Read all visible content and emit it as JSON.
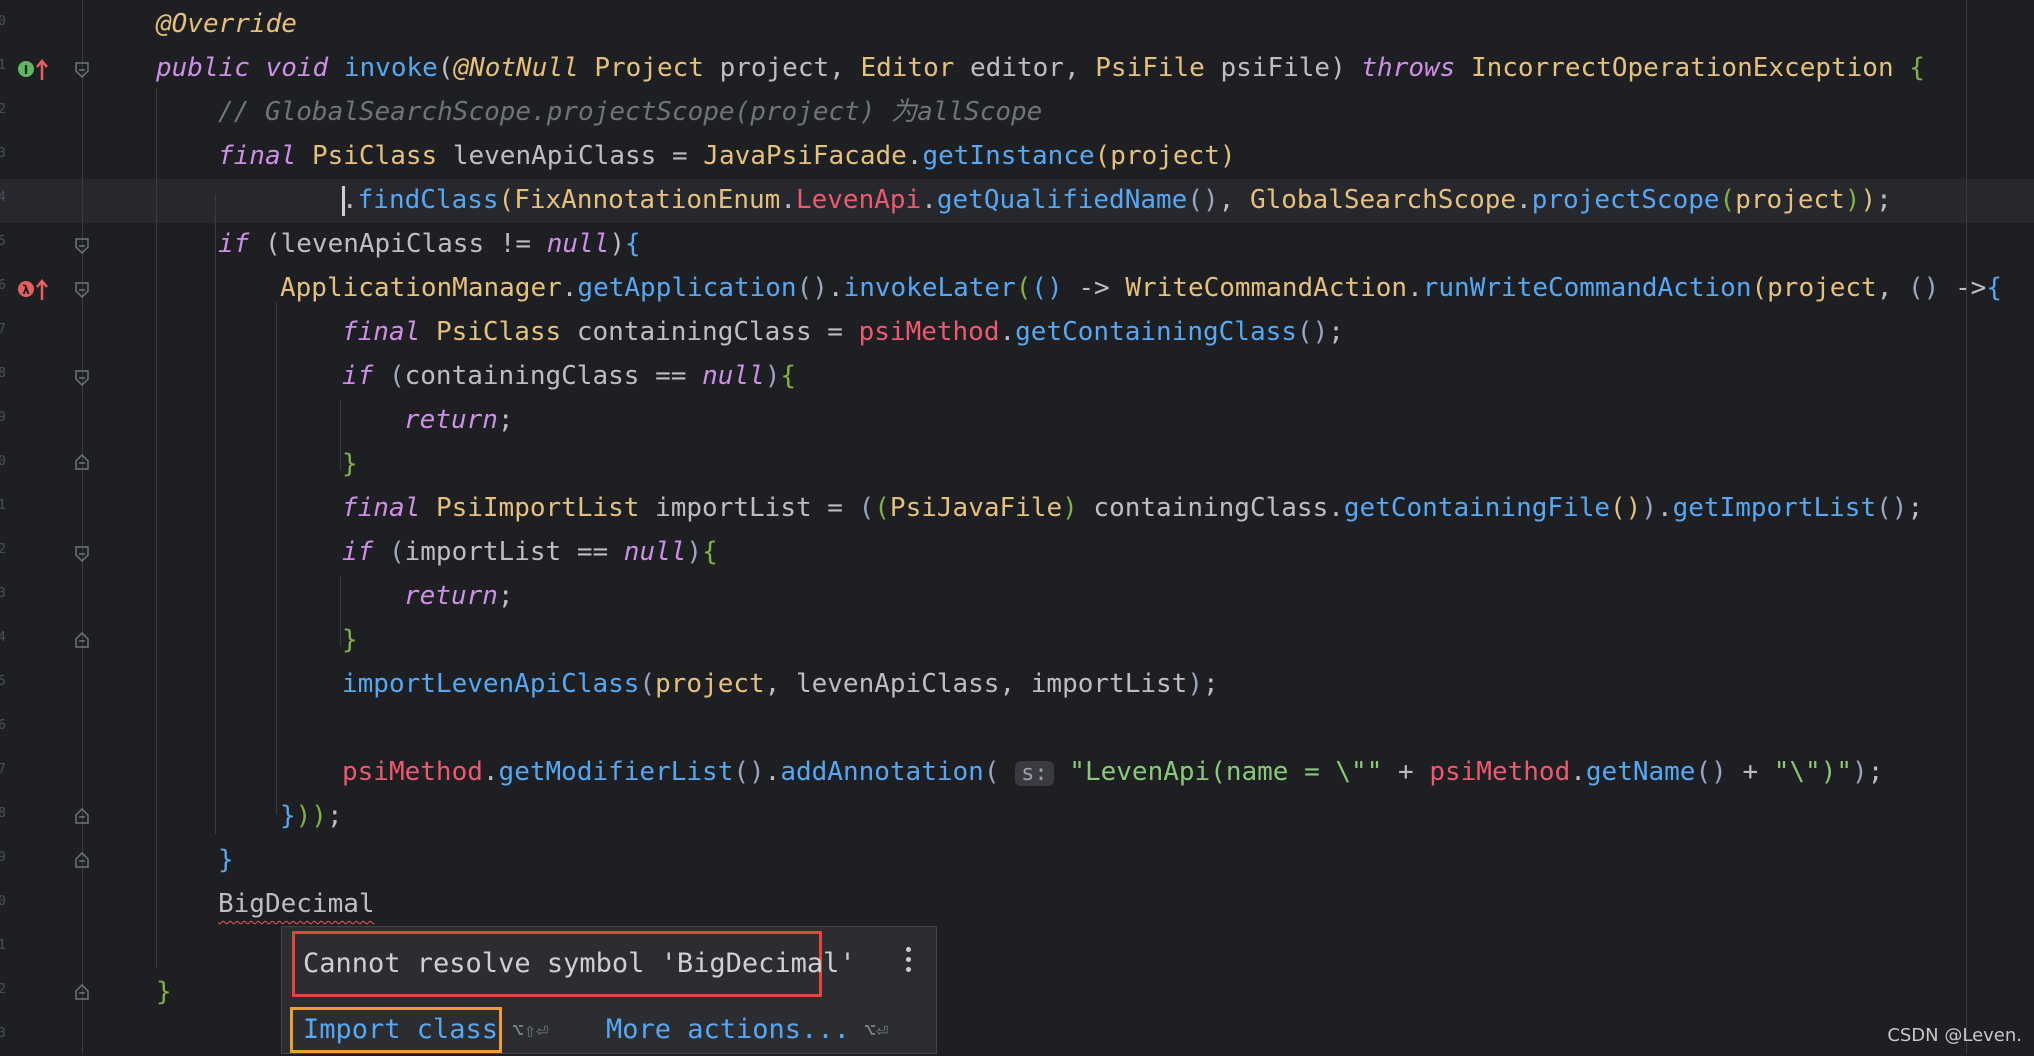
{
  "colors": {
    "background": "#1e1f22",
    "keyword": "#cf8ee8",
    "type": "#e5c17c",
    "method": "#56a8f5",
    "field": "#ef596f",
    "string": "#89ca78",
    "comment": "#6f737a",
    "error_border": "#e2473c",
    "action_border": "#e8a030"
  },
  "gutter": {
    "line_numbers": [
      "0",
      "1",
      "2",
      "3",
      "4",
      "5",
      "6",
      "7",
      "8",
      "9",
      "0",
      "1",
      "2",
      "3",
      "4",
      "5",
      "6",
      "7",
      "8",
      "9",
      "0",
      "1",
      "2",
      "3"
    ]
  },
  "code": {
    "l1": {
      "annotation": "@Override"
    },
    "l2": {
      "public": "public",
      "void": "void",
      "method": "invoke",
      "open": "(",
      "notnull": "@NotNull",
      "t1": "Project",
      "p1": "project",
      "c1": ",",
      "t2": "Editor",
      "p2": "editor",
      "c2": ",",
      "t3": "PsiFile",
      "p3": "psiFile",
      "close": ")",
      "throws": "throws",
      "ex": "IncorrectOperationException",
      "brace": "{"
    },
    "l3": {
      "comment": "// GlobalSearchScope.projectScope(project) 为allScope"
    },
    "l4": {
      "final": "final",
      "type": "PsiClass",
      "var": "levenApiClass",
      "eq": "=",
      "cls": "JavaPsiFacade",
      "dot": ".",
      "method": "getInstance",
      "open": "(",
      "arg": "project",
      "close": ")"
    },
    "l5": {
      "dot": ".",
      "method": "findClass",
      "open": "(",
      "cls": "FixAnnotationEnum",
      "dot2": ".",
      "field": "LevenApi",
      "dot3": ".",
      "m2": "getQualifiedName",
      "parens": "()",
      "comma": ",",
      "cls2": "GlobalSearchScope",
      "dot4": ".",
      "m3": "projectScope",
      "open2": "(",
      "arg": "project",
      "close2": ")",
      "close": ")",
      "semi": ";"
    },
    "l6": {
      "if": "if",
      "open": "(",
      "var": "levenApiClass",
      "op": "!=",
      "null": "null",
      "close": ")",
      "brace": "{"
    },
    "l7": {
      "cls": "ApplicationManager",
      "dot": ".",
      "m1": "getApplication",
      "p1": "()",
      "dot2": ".",
      "m2": "invokeLater",
      "open": "(",
      "lam": "()",
      "arrow": "->",
      "cls2": "WriteCommandAction",
      "dot3": ".",
      "m3": "runWriteCommandAction",
      "open2": "(",
      "arg": "project",
      "comma": ",",
      "lam2": "()",
      "arrow2": "->",
      "brace": "{"
    },
    "l8": {
      "final": "final",
      "type": "PsiClass",
      "var": "containingClass",
      "eq": "=",
      "field": "psiMethod",
      "dot": ".",
      "method": "getContainingClass",
      "parens": "()",
      "semi": ";"
    },
    "l9": {
      "if": "if",
      "open": "(",
      "var": "containingClass",
      "op": "==",
      "null": "null",
      "close": ")",
      "brace": "{"
    },
    "l10": {
      "return": "return",
      "semi": ";"
    },
    "l11": {
      "brace": "}"
    },
    "l12": {
      "final": "final",
      "type": "PsiImportList",
      "var": "importList",
      "eq": "=",
      "open": "(",
      "open2": "(",
      "cast": "PsiJavaFile",
      "close2": ")",
      "obj": "containingClass",
      "dot": ".",
      "m1": "getContainingFile",
      "p1": "()",
      "close": ")",
      "dot2": ".",
      "m2": "getImportList",
      "p2": "()",
      "semi": ";"
    },
    "l13": {
      "if": "if",
      "open": "(",
      "var": "importList",
      "op": "==",
      "null": "null",
      "close": ")",
      "brace": "{"
    },
    "l14": {
      "return": "return",
      "semi": ";"
    },
    "l15": {
      "brace": "}"
    },
    "l16": {
      "method": "importLevenApiClass",
      "open": "(",
      "a1": "project",
      "c1": ",",
      "a2": "levenApiClass",
      "c2": ",",
      "a3": "importList",
      "close": ")",
      "semi": ";"
    },
    "l18": {
      "field": "psiMethod",
      "dot": ".",
      "m1": "getModifierList",
      "p1": "()",
      "dot2": ".",
      "m2": "addAnnotation",
      "open": "(",
      "hint": "s:",
      "s1": "\"LevenApi(name = \\\"\"",
      "plus": "+",
      "field2": "psiMethod",
      "dot3": ".",
      "m3": "getName",
      "p2": "()",
      "plus2": "+",
      "s2": "\"\\\")\"",
      "close": ")",
      "semi": ";"
    },
    "l19": {
      "close": "}",
      "parens": "))",
      "semi": ";"
    },
    "l20": {
      "brace": "}"
    },
    "l21": {
      "text": "BigDecimal"
    },
    "l23": {
      "brace": "}"
    }
  },
  "popup": {
    "message": "Cannot resolve symbol 'BigDecimal'",
    "import_label": "Import class",
    "import_shortcut": "⌥⇧⏎",
    "more_label": "More actions...",
    "more_shortcut": "⌥⏎"
  },
  "watermark": "CSDN @Leven."
}
